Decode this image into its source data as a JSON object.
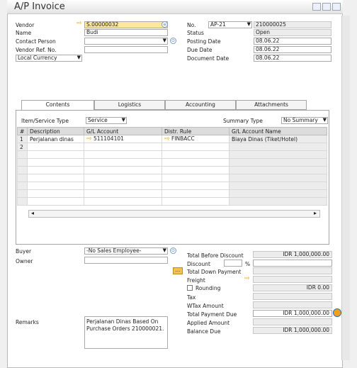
{
  "window": {
    "title": "A/P Invoice"
  },
  "header_left": {
    "vendor_label": "Vendor",
    "vendor_value": "S.00000032",
    "name_label": "Name",
    "name_value": "Budi",
    "contact_label": "Contact Person",
    "contact_value": "",
    "refno_label": "Vendor Ref. No.",
    "refno_value": "",
    "currency_value": "Local Currency"
  },
  "header_right": {
    "no_label": "No.",
    "series_value": "AP-21",
    "doc_number": "210000025",
    "status_label": "Status",
    "status_value": "Open",
    "posting_label": "Posting Date",
    "posting_value": "08.06.22",
    "due_label": "Due Date",
    "due_value": "08.06.22",
    "docdate_label": "Document Date",
    "docdate_value": "08.06.22"
  },
  "tabs": [
    "Contents",
    "Logistics",
    "Accounting",
    "Attachments"
  ],
  "contents": {
    "item_type_label": "Item/Service Type",
    "item_type_value": "Service",
    "summary_label": "Summary Type",
    "summary_value": "No Summary",
    "columns": [
      "#",
      "Description",
      "G/L Account",
      "Distr. Rule",
      "G/L Account Name"
    ],
    "rows": [
      {
        "num": "1",
        "description": "Perjalanan dinas",
        "gl_account": "511104101",
        "distr_rule": "FINBACC",
        "gl_name": "Biaya Dinas (Tiket/Hotel)"
      },
      {
        "num": "2",
        "description": "",
        "gl_account": "",
        "distr_rule": "",
        "gl_name": ""
      }
    ]
  },
  "footer_left": {
    "buyer_label": "Buyer",
    "buyer_value": "-No Sales Employee-",
    "owner_label": "Owner",
    "owner_value": "",
    "remarks_label": "Remarks",
    "remarks_value": "Perjalanan Dinas Based On Purchase Orders 210000021."
  },
  "totals": {
    "before_discount_label": "Total Before Discount",
    "before_discount_value": "IDR 1,000,000.00",
    "discount_label": "Discount",
    "discount_pct_symbol": "%",
    "down_payment_label": "Total Down Payment",
    "freight_label": "Freight",
    "rounding_label": "Rounding",
    "rounding_value": "IDR 0.00",
    "tax_label": "Tax",
    "wtax_label": "WTax Amount",
    "payment_due_label": "Total Payment Due",
    "payment_due_value": "IDR 1,000,000.00",
    "applied_label": "Applied Amount",
    "balance_label": "Balance Due",
    "balance_value": "IDR 1,000,000.00",
    "ellipsis": "..."
  }
}
